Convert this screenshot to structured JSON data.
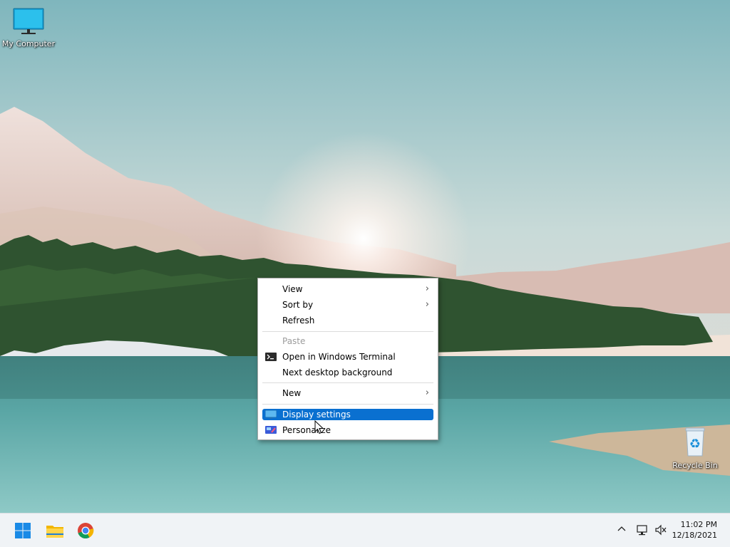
{
  "desktop": {
    "icons": [
      {
        "label": "My Computer",
        "icon": "computer-monitor-icon"
      },
      {
        "label": "Recycle Bin",
        "icon": "recycle-bin-icon"
      }
    ]
  },
  "context_menu": {
    "items": [
      {
        "label": "View",
        "has_submenu": true
      },
      {
        "label": "Sort by",
        "has_submenu": true
      },
      {
        "label": "Refresh"
      },
      {
        "label": "Paste",
        "disabled": true
      },
      {
        "label": "Open in Windows Terminal",
        "icon": "terminal-icon"
      },
      {
        "label": "Next desktop background"
      },
      {
        "label": "New",
        "has_submenu": true
      },
      {
        "label": "Display settings",
        "icon": "display-icon",
        "selected": true
      },
      {
        "label": "Personalize",
        "icon": "personalize-icon"
      }
    ],
    "selected_color": "#0a70d0"
  },
  "taskbar": {
    "apps": [
      {
        "name": "Start",
        "icon": "windows-start-icon"
      },
      {
        "name": "File Explorer",
        "icon": "file-explorer-icon"
      },
      {
        "name": "Google Chrome",
        "icon": "chrome-icon"
      }
    ],
    "tray_icons": [
      "chevron-up-icon",
      "network-icon",
      "volume-muted-icon"
    ],
    "clock": {
      "time": "11:02 PM",
      "date": "12/18/2021"
    }
  }
}
